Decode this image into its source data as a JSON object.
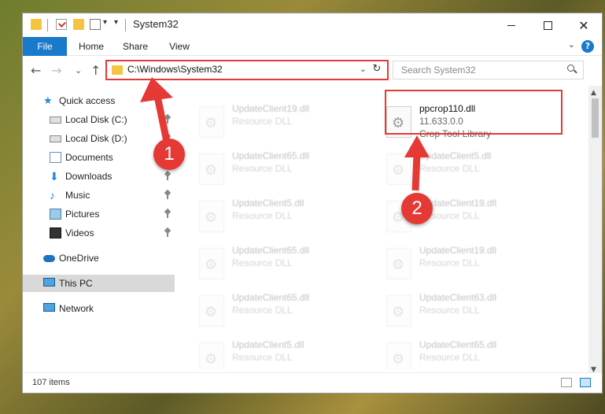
{
  "window": {
    "title": "System32"
  },
  "ribbon": {
    "tabs": [
      "File",
      "Home",
      "Share",
      "View"
    ]
  },
  "address": {
    "path": "C:\\Windows\\System32"
  },
  "search": {
    "placeholder": "Search System32"
  },
  "sidebar": {
    "items": [
      {
        "label": "Quick access",
        "icon": "star-icon",
        "pinned": false
      },
      {
        "label": "Local Disk (C:)",
        "icon": "disk-icon",
        "pinned": true
      },
      {
        "label": "Local Disk (D:)",
        "icon": "disk-icon",
        "pinned": true
      },
      {
        "label": "Documents",
        "icon": "document-icon",
        "pinned": true
      },
      {
        "label": "Downloads",
        "icon": "download-icon",
        "pinned": true
      },
      {
        "label": "Music",
        "icon": "music-icon",
        "pinned": true
      },
      {
        "label": "Pictures",
        "icon": "pictures-icon",
        "pinned": true
      },
      {
        "label": "Videos",
        "icon": "video-icon",
        "pinned": true
      },
      {
        "label": "OneDrive",
        "icon": "cloud-icon",
        "pinned": false
      },
      {
        "label": "This PC",
        "icon": "computer-icon",
        "pinned": false,
        "selected": true
      },
      {
        "label": "Network",
        "icon": "network-icon",
        "pinned": false
      }
    ]
  },
  "files": {
    "highlighted": {
      "name": "ppcrop110.dll",
      "version": "11.633.0.0",
      "description": "Crop Tool Library"
    },
    "left_column": [
      {
        "name": "UpdateClient19.dll",
        "type": "Resource DLL"
      },
      {
        "name": "UpdateClient65.dll",
        "type": "Resource DLL"
      },
      {
        "name": "UpdateClient5.dll",
        "type": "Resource DLL"
      },
      {
        "name": "UpdateClient65.dll",
        "type": "Resource DLL"
      },
      {
        "name": "UpdateClient65.dll",
        "type": "Resource DLL"
      },
      {
        "name": "UpdateClient5.dll",
        "type": "Resource DLL"
      }
    ],
    "right_column": [
      {
        "name": "UpdateClient5.dll",
        "type": "Resource DLL"
      },
      {
        "name": "UpdateClient19.dll",
        "type": "Resource DLL"
      },
      {
        "name": "UpdateClient19.dll",
        "type": "Resource DLL"
      },
      {
        "name": "UpdateClient63.dll",
        "type": "Resource DLL"
      },
      {
        "name": "UpdateClient65.dll",
        "type": "Resource DLL"
      }
    ]
  },
  "status": {
    "item_count": "107 items"
  },
  "annotations": {
    "step1": "1",
    "step2": "2",
    "color": "#e53935"
  }
}
